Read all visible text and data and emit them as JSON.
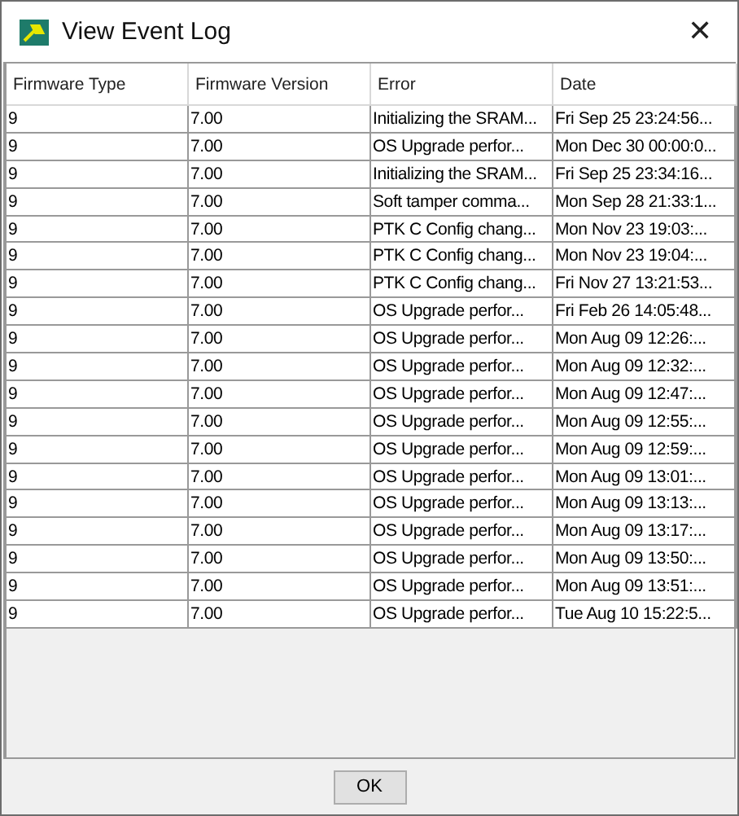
{
  "window": {
    "title": "View Event Log",
    "close": "✕"
  },
  "table": {
    "columns": [
      "Firmware Type",
      "Firmware Version",
      "Error",
      "Date"
    ],
    "rows": [
      [
        "9",
        "7.00",
        "Initializing the SRAM...",
        "Fri Sep 25 23:24:56..."
      ],
      [
        "9",
        "7.00",
        "OS Upgrade perfor...",
        "Mon Dec 30 00:00:0..."
      ],
      [
        "9",
        "7.00",
        "Initializing the SRAM...",
        "Fri Sep 25 23:34:16..."
      ],
      [
        "9",
        "7.00",
        "Soft tamper comma...",
        "Mon Sep 28 21:33:1..."
      ],
      [
        "9",
        "7.00",
        "PTK C Config chang...",
        "Mon Nov 23 19:03:..."
      ],
      [
        "9",
        "7.00",
        "PTK C Config chang...",
        "Mon Nov 23 19:04:..."
      ],
      [
        "9",
        "7.00",
        "PTK C Config chang...",
        "Fri Nov 27 13:21:53..."
      ],
      [
        "9",
        "7.00",
        "OS Upgrade perfor...",
        "Fri Feb 26 14:05:48..."
      ],
      [
        "9",
        "7.00",
        "OS Upgrade perfor...",
        "Mon Aug 09 12:26:..."
      ],
      [
        "9",
        "7.00",
        "OS Upgrade perfor...",
        "Mon Aug 09 12:32:..."
      ],
      [
        "9",
        "7.00",
        "OS Upgrade perfor...",
        "Mon Aug 09 12:47:..."
      ],
      [
        "9",
        "7.00",
        "OS Upgrade perfor...",
        "Mon Aug 09 12:55:..."
      ],
      [
        "9",
        "7.00",
        "OS Upgrade perfor...",
        "Mon Aug 09 12:59:..."
      ],
      [
        "9",
        "7.00",
        "OS Upgrade perfor...",
        "Mon Aug 09 13:01:..."
      ],
      [
        "9",
        "7.00",
        "OS Upgrade perfor...",
        "Mon Aug 09 13:13:..."
      ],
      [
        "9",
        "7.00",
        "OS Upgrade perfor...",
        "Mon Aug 09 13:17:..."
      ],
      [
        "9",
        "7.00",
        "OS Upgrade perfor...",
        "Mon Aug 09 13:50:..."
      ],
      [
        "9",
        "7.00",
        "OS Upgrade perfor...",
        "Mon Aug 09 13:51:..."
      ],
      [
        "9",
        "7.00",
        "OS Upgrade perfor...",
        "Tue Aug 10 15:22:5..."
      ]
    ]
  },
  "buttons": [
    "OK"
  ]
}
